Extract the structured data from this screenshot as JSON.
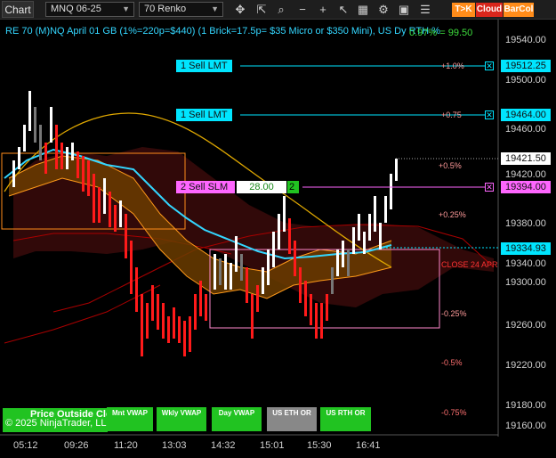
{
  "toolbar": {
    "chart_label": "Chart",
    "instrument": "MNQ 06-25",
    "bar_type": "70 Renko",
    "icons": [
      "crosshair-icon",
      "pointer-icon",
      "zoom-icon",
      "minus-icon",
      "plus-icon",
      "cursor-icon",
      "grid-icon",
      "properties-icon",
      "window-icon",
      "list-icon"
    ],
    "tk_label": "T>K",
    "cloud_label": "Cloud",
    "barcol_label": "BarCol"
  },
  "header": {
    "ticker_text": "RE 70 (M)NQ April 01 GB (1%=220p=$440) (1 Brick=17.5p= $35 Micro or $350 Mini), US Dy RTH %",
    "right_text": "0.97% = 99.50"
  },
  "orders": [
    {
      "label": "1 Sell LMT",
      "price": "19512.25",
      "pct": "+1.0%"
    },
    {
      "label": "1 Sell LMT",
      "price": "19464.00",
      "pct": "+0.75"
    },
    {
      "label": "2 Sell SLM",
      "price": "19394.00",
      "value": "28.00",
      "count": "2"
    }
  ],
  "current_price": "19421.50",
  "last_price": "19334.93",
  "axis": {
    "prices": [
      "19540.00",
      "19500.00",
      "19460.00",
      "19420.00",
      "19380.00",
      "19340.00",
      "19300.00",
      "19260.00",
      "19220.00",
      "19180.00",
      "19160.00"
    ],
    "times": [
      "05:12",
      "09:26",
      "11:20",
      "13:03",
      "14:32",
      "15:01",
      "15:30",
      "16:41"
    ]
  },
  "percent_levels": [
    {
      "label": "+0.5%",
      "color": "#ff9a9a"
    },
    {
      "label": "+0.25%",
      "color": "#ff9a9a"
    },
    {
      "label": "-0.25%",
      "color": "#ff9a9a"
    },
    {
      "label": "-0.5%",
      "color": "#ff7070"
    },
    {
      "label": "-0.75%",
      "color": "#ff7070"
    }
  ],
  "close_label": "CLOSE 24 APR",
  "bottom_bar": {
    "position_text": "Price Outside Clo",
    "copyright": "© 2025 NinjaTrader, LLC",
    "buttons": [
      "Mnt VWAP",
      "Wkly VWAP",
      "Day VWAP",
      "US ETH OR",
      "US RTH OR"
    ]
  },
  "colors": {
    "accent_cyan": "#00e5ff",
    "sell_slm": "#ff66ff",
    "green": "#21c321",
    "toolbar_orange": "#ff8c1a",
    "toolbar_red": "#d9261c"
  }
}
